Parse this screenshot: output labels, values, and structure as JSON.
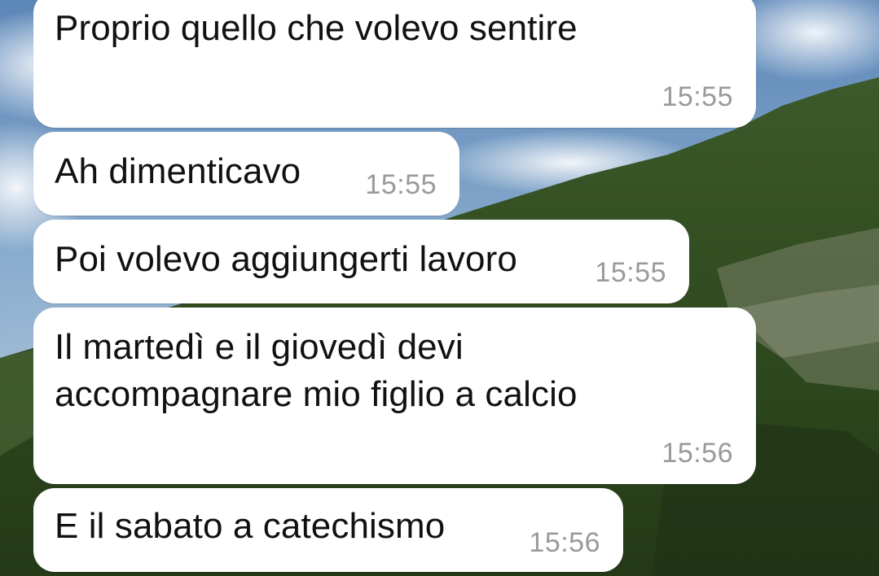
{
  "colors": {
    "bubble_background": "#ffffff",
    "message_text": "#111111",
    "timestamp_text": "#9a9a9a",
    "sky": "#6a8fb5",
    "hill": "#2f4a1f"
  },
  "messages": [
    {
      "text": "Proprio quello che volevo sentire",
      "time": "15:55"
    },
    {
      "text": "Ah dimenticavo",
      "time": "15:55"
    },
    {
      "text": "Poi volevo aggiungerti lavoro",
      "time": "15:55"
    },
    {
      "text": "Il martedì e il giovedì devi\naccompagnare mio figlio a calcio",
      "time": "15:56"
    },
    {
      "text": "E il sabato a catechismo",
      "time": "15:56"
    }
  ]
}
